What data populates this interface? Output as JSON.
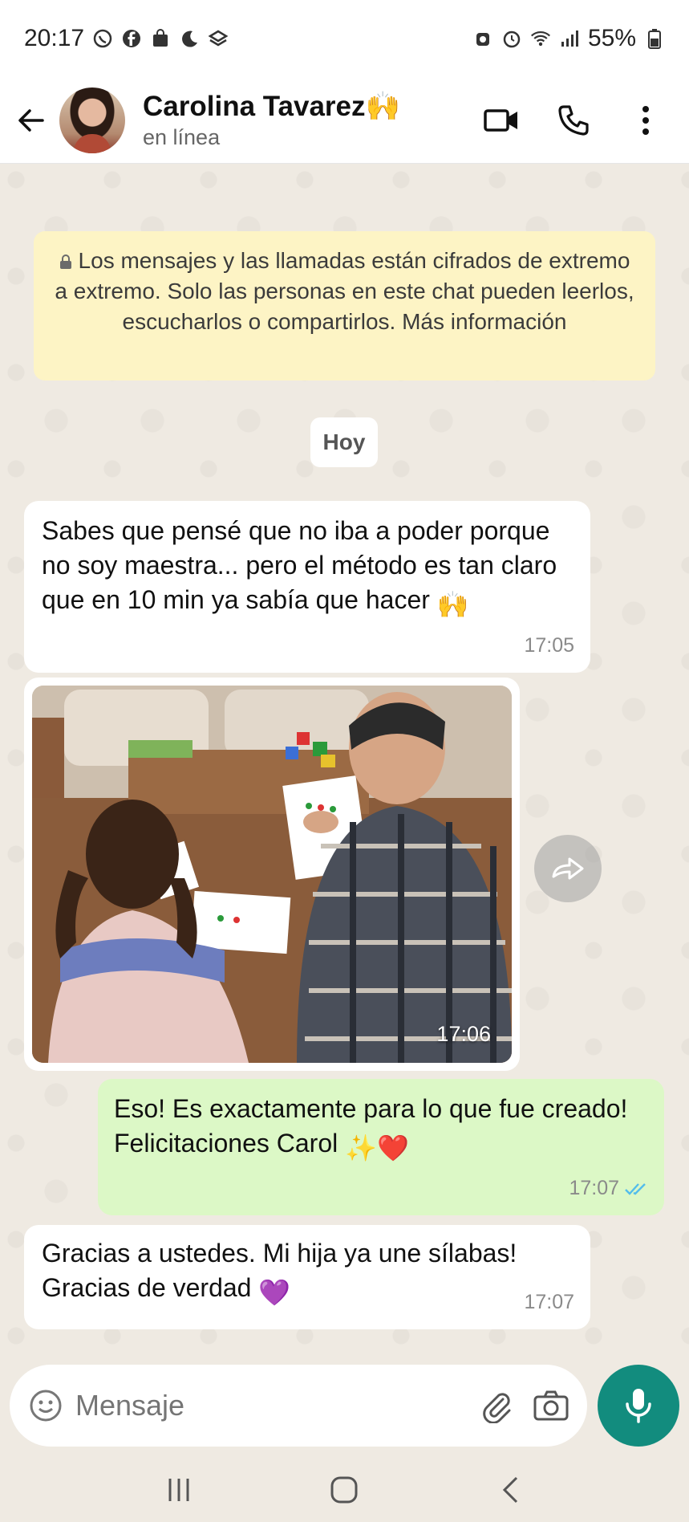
{
  "status_bar": {
    "time": "20:17",
    "battery": "55%",
    "left_icons": [
      "whatsapp-icon",
      "facebook-icon",
      "bag-icon",
      "moon-icon",
      "app-icon"
    ],
    "right_icons": [
      "alarm-icon",
      "alarm-clock-icon",
      "wifi-icon",
      "signal-icon",
      "battery-icon"
    ]
  },
  "header": {
    "contact_name": "Carolina Tavarez",
    "name_emoji": "🙌",
    "status": "en línea",
    "actions": [
      "video-call-icon",
      "phone-icon",
      "more-icon"
    ]
  },
  "chat": {
    "encryption_notice": "Los mensajes y las llamadas están cifrados de extremo a extremo. Solo las personas en este chat pueden leerlos, escucharlos o compartirlos. Más información",
    "date_chip": "Hoy",
    "messages": [
      {
        "direction": "incoming",
        "text": "Sabes que pensé que no iba a poder porque no soy maestra... pero el método es tan claro que en 10 min ya sabía que hacer",
        "emoji": "🙌",
        "time": "17:05"
      },
      {
        "direction": "incoming",
        "type": "image",
        "time": "17:06"
      },
      {
        "direction": "outgoing",
        "text": "Eso! Es exactamente para lo que fue creado! Felicitaciones Carol",
        "emoji": "✨❤️",
        "time": "17:07",
        "status": "read"
      },
      {
        "direction": "incoming",
        "text": "Gracias a ustedes. Mi hija ya une sílabas! Gracias de verdad",
        "emoji": "💜",
        "time": "17:07"
      }
    ]
  },
  "composer": {
    "placeholder": "Mensaje"
  },
  "colors": {
    "chat_bg": "#efeae2",
    "outgoing_bubble": "#dcf8c6",
    "incoming_bubble": "#ffffff",
    "notice_bg": "#fdf4c5",
    "accent": "#128c7e",
    "read_tick": "#53bdeb"
  }
}
